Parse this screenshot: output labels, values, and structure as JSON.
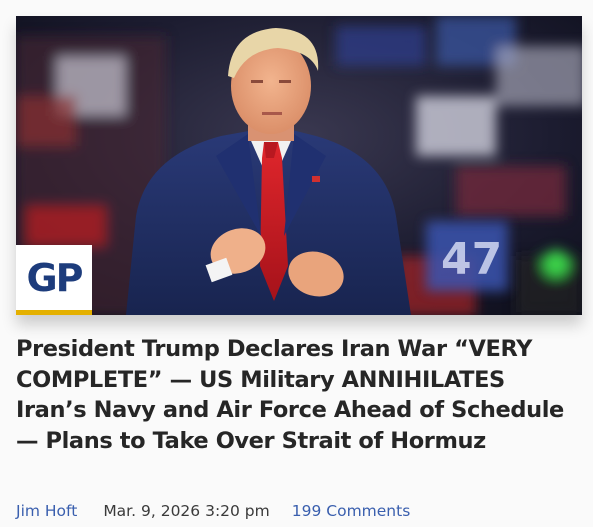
{
  "article": {
    "logo_text": "GP",
    "image_sign_text": "47",
    "headline": "President Trump Declares Iran War “VERY COMPLETE” — US Military ANNIHILATES Iran’s Navy and Air Force Ahead of Schedule — Plans to Take Over Strait of Hormuz",
    "author": "Jim Hoft",
    "date": "Mar. 9, 2026 3:20 pm",
    "comments": "199 Comments"
  },
  "colors": {
    "link": "#3a5fae",
    "headline": "#262626",
    "logo_blue": "#1d3c7c",
    "logo_bar": "#e4b000"
  }
}
